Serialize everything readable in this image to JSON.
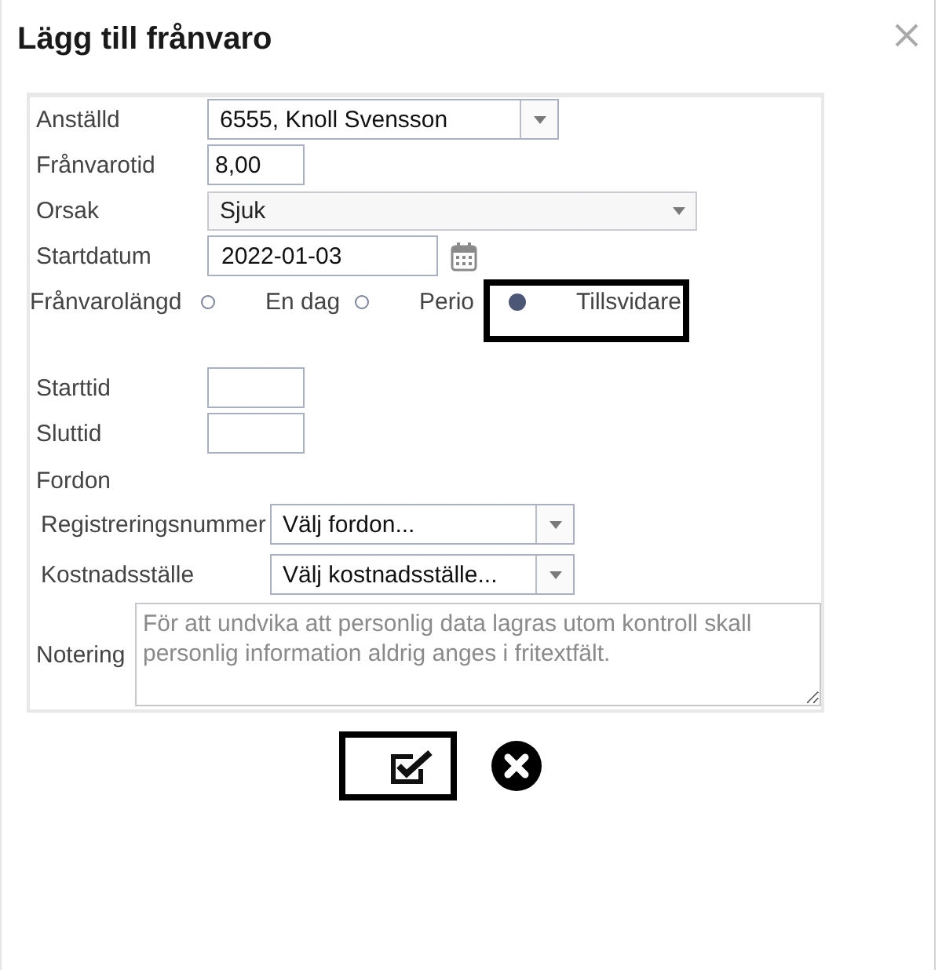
{
  "dialog": {
    "title": "Lägg till frånvaro"
  },
  "form": {
    "fields": [
      {
        "kind": "combo",
        "label": "Anställd",
        "value": "6555, Knoll Svensson"
      },
      {
        "kind": "text",
        "label": "Frånvarotid",
        "value": "8,00"
      },
      {
        "kind": "select",
        "label": "Orsak",
        "value": "Sjuk"
      },
      {
        "kind": "date",
        "label": "Startdatum",
        "value": "2022-01-03"
      },
      {
        "kind": "radio",
        "label": "Frånvarolängd",
        "options": [
          {
            "label": "En dag",
            "selected": false,
            "highlighted": false
          },
          {
            "label": "Perio",
            "selected": false,
            "highlighted": false
          },
          {
            "label": "Tillsvidare",
            "selected": true,
            "highlighted": true
          }
        ]
      },
      {
        "kind": "text",
        "label": "Starttid"
      },
      {
        "kind": "text",
        "label": "Sluttid"
      }
    ],
    "vehicle": {
      "heading": "Fordon",
      "fields": [
        {
          "kind": "combo",
          "label": "Registreringsnummer",
          "value": "Välj fordon..."
        },
        {
          "kind": "combo",
          "label": "Kostnadsställe",
          "value": "Välj kostnadsställe..."
        }
      ]
    },
    "note": {
      "label": "Notering",
      "placeholder": "För att undvika att personlig data lagras utom kontroll skall personlig information aldrig anges i fritextfält."
    }
  },
  "actions": [
    {
      "kind": "save",
      "highlighted": true
    },
    {
      "kind": "cancel",
      "highlighted": false
    }
  ]
}
